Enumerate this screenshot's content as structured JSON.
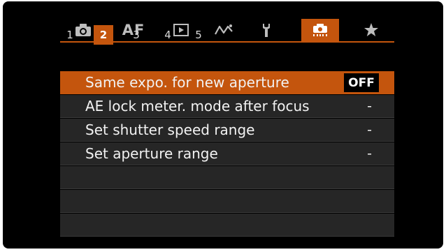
{
  "tabs": [
    {
      "name": "camera-shooting",
      "icon": "camera-icon",
      "label": ""
    },
    {
      "name": "af",
      "icon": "",
      "label": "AF"
    },
    {
      "name": "playback",
      "icon": "playback-icon",
      "label": ""
    },
    {
      "name": "wireless",
      "icon": "wireless-icon",
      "label": ""
    },
    {
      "name": "setup",
      "icon": "wrench-icon",
      "label": ""
    },
    {
      "name": "custom-functions",
      "icon": "custom-functions-icon",
      "label": ""
    },
    {
      "name": "my-menu",
      "icon": "star-icon",
      "label": ""
    }
  ],
  "active_tab": "custom-functions",
  "subtabs": [
    "1",
    "2",
    "3",
    "4",
    "5"
  ],
  "active_subtab": "2",
  "menu": {
    "items": [
      {
        "label": "Same expo. for new aperture",
        "value": "OFF",
        "selected": true
      },
      {
        "label": "AE lock meter. mode after focus",
        "value": "-",
        "selected": false
      },
      {
        "label": "Set shutter speed range",
        "value": "-",
        "selected": false
      },
      {
        "label": "Set aperture range",
        "value": "-",
        "selected": false
      },
      {
        "label": "",
        "value": "",
        "selected": false
      },
      {
        "label": "",
        "value": "",
        "selected": false
      },
      {
        "label": "",
        "value": "",
        "selected": false
      }
    ]
  },
  "colors": {
    "accent": "#c4550d",
    "background": "#000000",
    "row": "#262626",
    "text": "#f2f2f2"
  }
}
